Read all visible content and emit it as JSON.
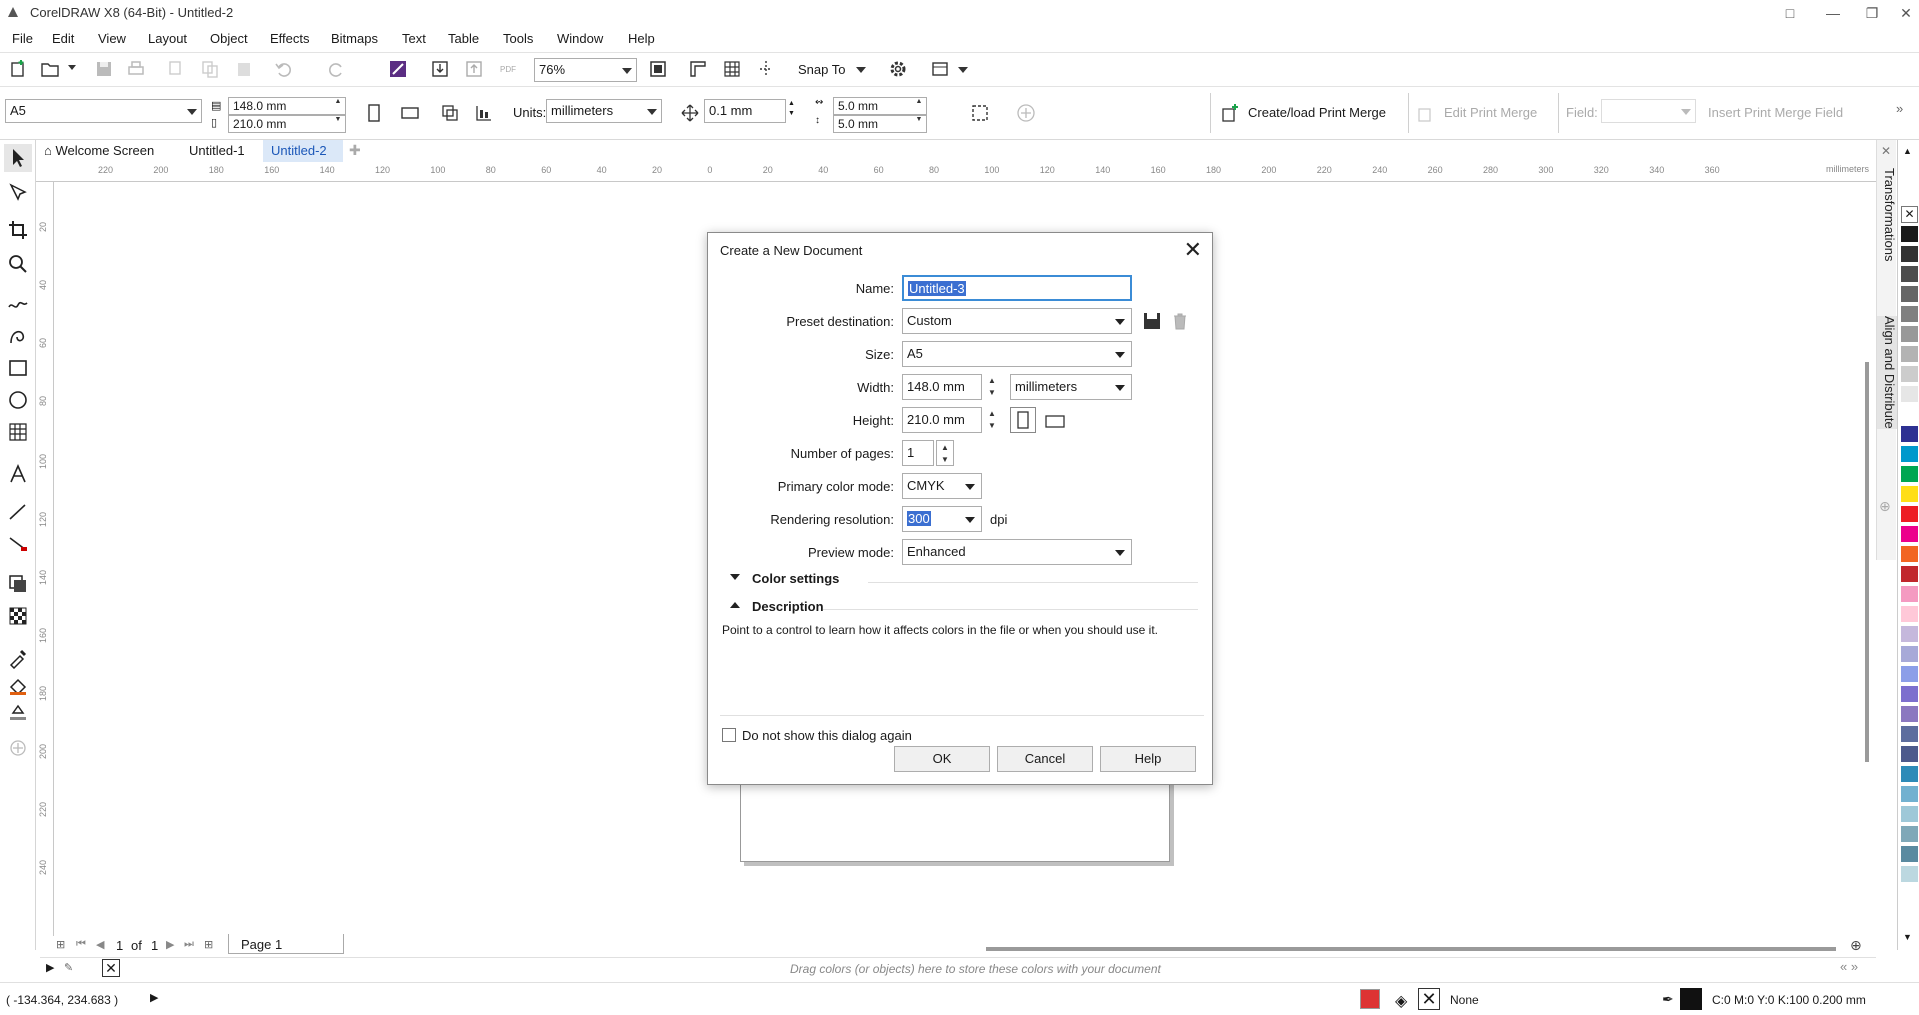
{
  "window": {
    "title": "CorelDRAW X8 (64-Bit) - Untitled-2"
  },
  "menu": [
    "File",
    "Edit",
    "View",
    "Layout",
    "Object",
    "Effects",
    "Bitmaps",
    "Text",
    "Table",
    "Tools",
    "Window",
    "Help"
  ],
  "toolbar": {
    "zoom": "76%",
    "snap_to": "Snap To"
  },
  "property_bar": {
    "page_size": "A5",
    "width": "148.0 mm",
    "height": "210.0 mm",
    "units_label": "Units:",
    "units": "millimeters",
    "nudge": "0.1 mm",
    "dup_x": "5.0 mm",
    "dup_y": "5.0 mm",
    "print_merge": "Create/load Print Merge",
    "edit_print_merge": "Edit Print Merge",
    "field_label": "Field:",
    "insert_field": "Insert Print Merge Field"
  },
  "tabs": [
    "Welcome Screen",
    "Untitled-1",
    "Untitled-2"
  ],
  "ruler": {
    "unit": "millimeters",
    "h_ticks": [
      "220",
      "200",
      "180",
      "160",
      "140",
      "120",
      "100",
      "80",
      "60",
      "40",
      "20",
      "0",
      "20",
      "40",
      "60",
      "80",
      "100",
      "120",
      "140",
      "160",
      "180",
      "200",
      "220",
      "240",
      "260",
      "280",
      "300",
      "320",
      "340",
      "360"
    ],
    "v_ticks": [
      "20",
      "40",
      "60",
      "80",
      "100",
      "120",
      "140",
      "160",
      "180",
      "200",
      "220",
      "240"
    ]
  },
  "page_nav": {
    "current": "1",
    "of": "of",
    "total": "1",
    "page_tab": "Page 1"
  },
  "color_tray_hint": "Drag colors (or objects) here to store these colors with your document",
  "status": {
    "coords": "( -134.364, 234.683 )",
    "fill": "None",
    "outline": "C:0 M:0 Y:0 K:100  0.200 mm"
  },
  "dockers": [
    "Transformations",
    "Align and Distribute"
  ],
  "palette": [
    "#1a1a1a",
    "#333333",
    "#4d4d4d",
    "#666666",
    "#808080",
    "#999999",
    "#b3b3b3",
    "#cccccc",
    "#e6e6e6",
    "#ffffff",
    "#2e3192",
    "#0099cc",
    "#00a651",
    "#ffde17",
    "#ed1c24",
    "#ec008c",
    "#f26522",
    "#c1272d",
    "#f49ac1",
    "#ffc8d8",
    "#c5b8dc",
    "#a7a9d8",
    "#8c9ee8",
    "#7d6fce",
    "#8b78c0",
    "#5d6d9e",
    "#4d5a8c",
    "#2e8bb8",
    "#72b1d0",
    "#9ec8d8",
    "#7fa8b8",
    "#5a8aa0",
    "#bcd8e0"
  ],
  "dialog": {
    "title": "Create a New Document",
    "name_label": "Name:",
    "name": "Untitled-3",
    "preset_label": "Preset destination:",
    "preset": "Custom",
    "size_label": "Size:",
    "size": "A5",
    "width_label": "Width:",
    "width": "148.0 mm",
    "units": "millimeters",
    "height_label": "Height:",
    "height": "210.0 mm",
    "pages_label": "Number of pages:",
    "pages": "1",
    "color_mode_label": "Primary color mode:",
    "color_mode": "CMYK",
    "resolution_label": "Rendering resolution:",
    "resolution": "300",
    "dpi": "dpi",
    "preview_label": "Preview mode:",
    "preview": "Enhanced",
    "color_settings": "Color settings",
    "description": "Description",
    "description_text": "Point to a control to learn how it affects colors in the file or when you should use it.",
    "dont_show": "Do not show this dialog again",
    "ok": "OK",
    "cancel": "Cancel",
    "help": "Help"
  }
}
